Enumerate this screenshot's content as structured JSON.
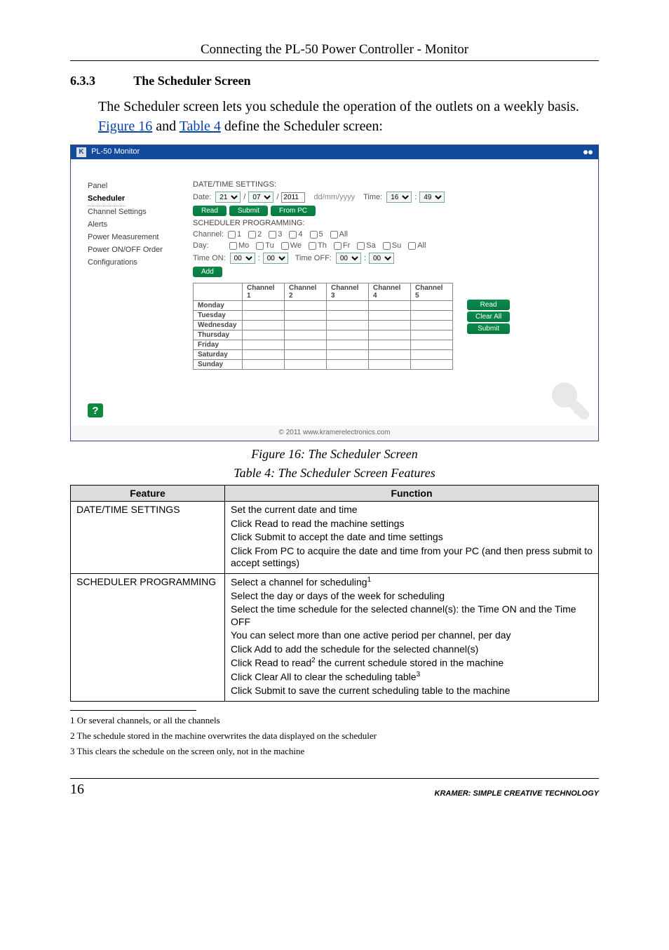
{
  "header": {
    "title": "Connecting the PL-50 Power Controller - Monitor"
  },
  "section": {
    "number": "6.3.3",
    "title": "The Scheduler Screen",
    "intro_prefix": "The Scheduler screen lets you schedule the operation of the outlets on a weekly basis. ",
    "link_fig": "Figure 16",
    "intro_mid": " and ",
    "link_tbl": "Table 4",
    "intro_suffix": " define the Scheduler screen:"
  },
  "screenshot": {
    "k_glyph": "K",
    "title": "PL-50 Monitor",
    "nav": {
      "items": [
        "Panel",
        "Scheduler",
        "Channel Settings",
        "Alerts",
        "Power Measurement",
        "Power ON/OFF Order",
        "Configurations"
      ],
      "current": "Scheduler"
    },
    "datetime": {
      "header": "DATE/TIME SETTINGS:",
      "date_label": "Date:",
      "date_day": "21",
      "sep": "/",
      "date_month": "07",
      "date_year": "2011",
      "hint": "dd/mm/yyyy",
      "time_label": "Time:",
      "time_h": "16",
      "time_sep": ":",
      "time_m": "49",
      "btn_read": "Read",
      "btn_submit": "Submit",
      "btn_pc": "From PC"
    },
    "prog": {
      "header": "SCHEDULER PROGRAMMING:",
      "channel_label": "Channel:",
      "channels": [
        "1",
        "2",
        "3",
        "4",
        "5",
        "All"
      ],
      "day_label": "Day:",
      "days_short": [
        "Mo",
        "Tu",
        "We",
        "Th",
        "Fr",
        "Sa",
        "Su",
        "All"
      ],
      "time_on_label": "Time ON:",
      "time_off_label": "Time OFF:",
      "zero": "00",
      "btn_add": "Add"
    },
    "table": {
      "cols": [
        "Channel 1",
        "Channel 2",
        "Channel 3",
        "Channel 4",
        "Channel 5"
      ],
      "rows": [
        "Monday",
        "Tuesday",
        "Wednesday",
        "Thursday",
        "Friday",
        "Saturday",
        "Sunday"
      ]
    },
    "side": {
      "read": "Read",
      "clear": "Clear All",
      "submit": "Submit"
    },
    "help": "?",
    "footer": "© 2011 www.kramerelectronics.com"
  },
  "captions": {
    "figure": "Figure 16: The Scheduler Screen",
    "table": "Table 4: The Scheduler Screen Features"
  },
  "features_table": {
    "head_feature": "Feature",
    "head_function": "Function",
    "rows": [
      {
        "feature": "DATE/TIME SETTINGS",
        "lines": [
          {
            "text": "Set the current date and time"
          },
          {
            "text": "Click Read to read the machine settings"
          },
          {
            "text": "Click Submit to accept the date and time settings"
          },
          {
            "text": "Click From PC to acquire the date and time from your PC (and then press submit to accept settings)"
          }
        ]
      },
      {
        "feature": "SCHEDULER PROGRAMMING",
        "lines": [
          {
            "text": "Select a channel for scheduling",
            "fn": "1"
          },
          {
            "text": "Select the day or days of the week for scheduling"
          },
          {
            "text": "Select the time schedule for the selected channel(s): the Time ON and the Time OFF"
          },
          {
            "text": "You can select more than one active period per channel, per day"
          },
          {
            "text": "Click Add to add the schedule for the selected channel(s)"
          },
          {
            "text_pre": "Click Read to read",
            "fn": "2",
            "text_post": " the current schedule stored in the machine"
          },
          {
            "text": "Click Clear All to clear the scheduling table",
            "fn": "3"
          },
          {
            "text": "Click Submit to save the current scheduling table to the machine"
          }
        ]
      }
    ]
  },
  "footnotes": [
    "1 Or several channels, or all the channels",
    "2 The schedule stored in the machine overwrites the data displayed on the scheduler",
    "3 This clears the schedule on the screen only, not in the machine"
  ],
  "footer": {
    "page": "16",
    "brand": "KRAMER:  SIMPLE CREATIVE TECHNOLOGY"
  }
}
